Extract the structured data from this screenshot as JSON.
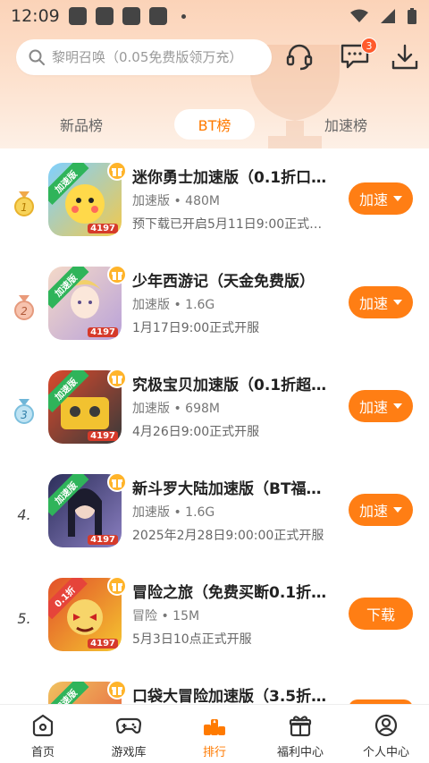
{
  "status": {
    "time": "12:09"
  },
  "search": {
    "placeholder": "黎明召唤（0.05免费版领万充）"
  },
  "header": {
    "message_badge": "3"
  },
  "tabs": [
    {
      "label": "新品榜",
      "active": false
    },
    {
      "label": "BT榜",
      "active": true
    },
    {
      "label": "加速榜",
      "active": false
    }
  ],
  "apps": [
    {
      "rank": "1",
      "name": "迷你勇士加速版（0.1折口…",
      "meta": "加速版 • 480M",
      "desc": "预下载已开启5月11日9:00正式…",
      "button": "加速",
      "has_caret": true,
      "ribbon": "加速版",
      "corner": "4197",
      "colors": [
        "#7fd0ff",
        "#f2c94c"
      ]
    },
    {
      "rank": "2",
      "name": "少年西游记（天金免费版）",
      "meta": "加速版 • 1.6G",
      "desc": "1月17日9:00正式开服",
      "button": "加速",
      "has_caret": true,
      "ribbon": "加速版",
      "corner": "4197",
      "colors": [
        "#f4d9c8",
        "#b9a2d9"
      ]
    },
    {
      "rank": "3",
      "name": "究极宝贝加速版（0.1折超…",
      "meta": "加速版 • 698M",
      "desc": "4月26日9:00正式开服",
      "button": "加速",
      "has_caret": true,
      "ribbon": "加速版",
      "corner": "4197",
      "colors": [
        "#d9492c",
        "#3a3a3a"
      ]
    },
    {
      "rank": "4.",
      "name": "新斗罗大陆加速版（BT福…",
      "meta": "加速版 • 1.6G",
      "desc": "2025年2月28日9:00:00正式开服",
      "button": "加速",
      "has_caret": true,
      "ribbon": "加速版",
      "corner": "4197",
      "colors": [
        "#2c2f5a",
        "#8a7ec0"
      ]
    },
    {
      "rank": "5.",
      "name": "冒险之旅（免费买断0.1折…",
      "meta": "冒险 • 15M",
      "desc": "5月3日10点正式开服",
      "button": "下载",
      "has_caret": false,
      "ribbon": "0.1折",
      "corner": "4197",
      "colors": [
        "#e2502a",
        "#f5c530"
      ]
    },
    {
      "rank": "",
      "name": "口袋大冒险加速版（3.5折…",
      "meta": "",
      "desc": "",
      "button": "",
      "has_caret": false,
      "ribbon": "加速版",
      "corner": "",
      "colors": [
        "#f0c260",
        "#e6553a"
      ]
    }
  ],
  "nav": [
    {
      "label": "首页",
      "icon": "home-icon",
      "active": false
    },
    {
      "label": "游戏库",
      "icon": "gamepad-icon",
      "active": false
    },
    {
      "label": "排行",
      "icon": "ranking-icon",
      "active": true
    },
    {
      "label": "福利中心",
      "icon": "gift-icon",
      "active": false
    },
    {
      "label": "个人中心",
      "icon": "user-icon",
      "active": false
    }
  ],
  "colors": {
    "accent": "#ff7e14",
    "header_gradient_top": "#fbd3b8"
  }
}
